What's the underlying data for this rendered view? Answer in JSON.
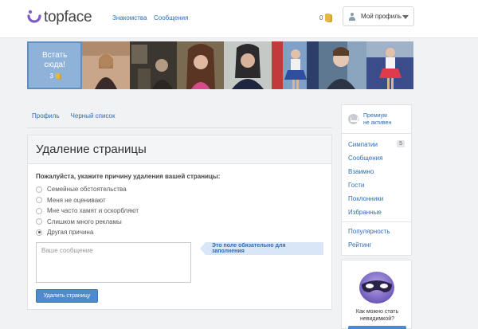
{
  "header": {
    "logo_text": "topface",
    "nav": [
      {
        "label": "Знакомства"
      },
      {
        "label": "Сообщения"
      }
    ],
    "coins": "0",
    "profile_label": "Мой профиль"
  },
  "promo": {
    "text": "Встать сюда!",
    "price": "3"
  },
  "tabs": [
    {
      "label": "Профиль"
    },
    {
      "label": "Черный список"
    }
  ],
  "card": {
    "title": "Удаление страницы",
    "question": "Пожалуйста, укажите причину удаления вашей страницы:",
    "options": [
      {
        "label": "Семейные обстоятельства",
        "selected": false
      },
      {
        "label": "Меня не оценивают",
        "selected": false
      },
      {
        "label": "Мне часто хамят и оскорбляют",
        "selected": false
      },
      {
        "label": "Слишком много рекламы",
        "selected": false
      },
      {
        "label": "Другая причина",
        "selected": true
      }
    ],
    "message_placeholder": "Ваше сообщение",
    "hint": "Это поле обязательно для заполнения",
    "delete_button": "Удалить страницу"
  },
  "sidebar": {
    "premium_line1": "Премиум",
    "premium_line2": "не активен",
    "items": [
      {
        "label": "Симпатии",
        "badge": "5"
      },
      {
        "label": "Сообщения"
      },
      {
        "label": "Взаимно"
      },
      {
        "label": "Гости"
      },
      {
        "label": "Поклонники"
      },
      {
        "label": "Избранные"
      }
    ],
    "items2": [
      {
        "label": "Популярность"
      },
      {
        "label": "Рейтинг"
      }
    ],
    "invisible_text": "Как можно стать невидимкой?"
  },
  "colors": {
    "accent": "#2d6cb5",
    "button": "#4f89d0",
    "promo_bg": "#8fb2d8"
  }
}
